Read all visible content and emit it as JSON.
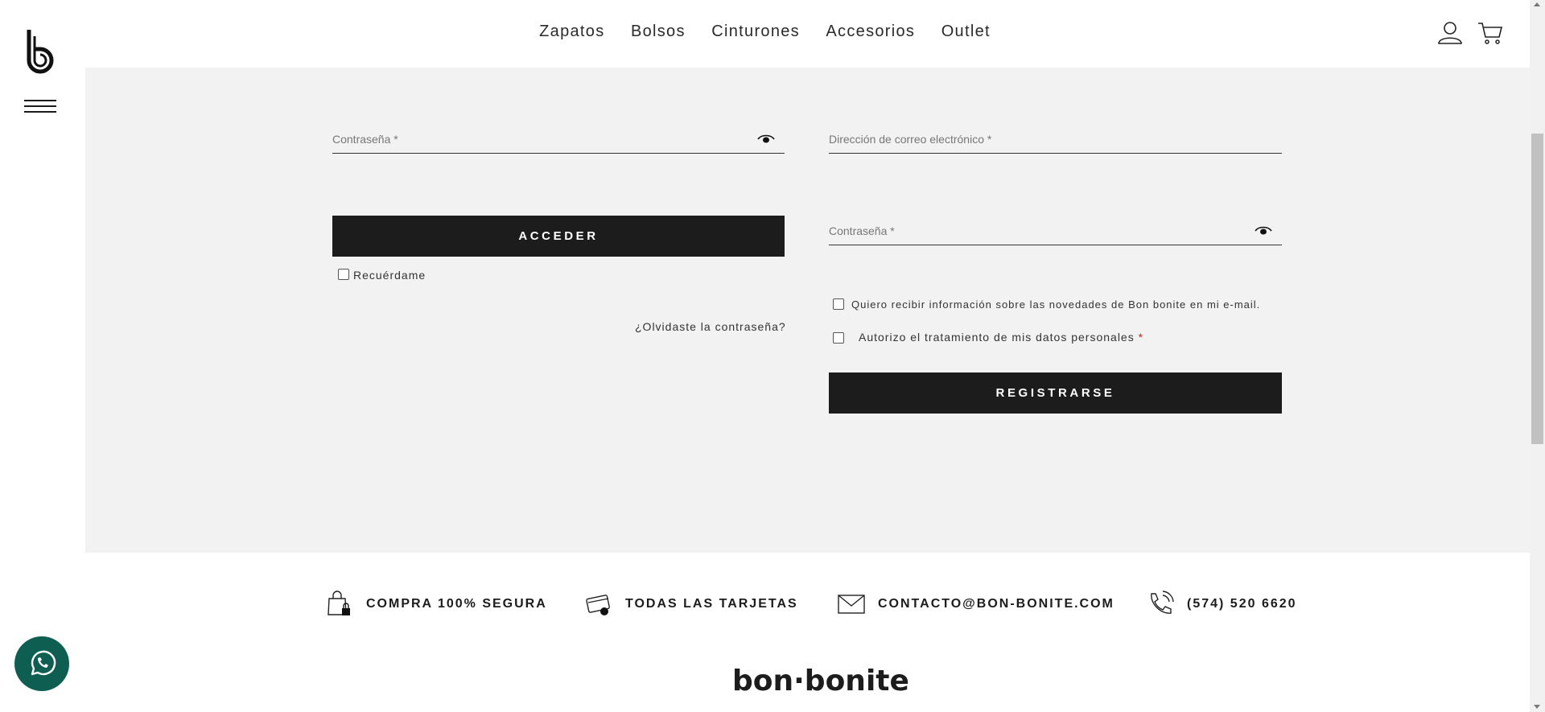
{
  "header": {
    "nav": [
      "Zapatos",
      "Bolsos",
      "Cinturones",
      "Accesorios",
      "Outlet"
    ],
    "logo_icon": "bonbonite-b-logo",
    "menu_icon": "hamburger-icon",
    "user_icon": "user-icon",
    "cart_icon": "cart-icon"
  },
  "login": {
    "password_label": "Contraseña *",
    "submit_label": "ACCEDER",
    "remember_label": "Recuérdame",
    "remember_checked": false,
    "forgot_link": "¿Olvidaste la contraseña?"
  },
  "register": {
    "email_label": "Dirección de correo electrónico *",
    "password_label": "Contraseña *",
    "newsletter_label": "Quiero recibir información sobre las novedades de Bon bonite en mi e-mail.",
    "newsletter_checked": false,
    "terms_label": "Autorizo el tratamiento de mis datos personales",
    "terms_required": "*",
    "terms_checked": false,
    "submit_label": "REGISTRARSE"
  },
  "features": [
    {
      "icon": "secure-bag-icon",
      "text": "COMPRA 100% SEGURA"
    },
    {
      "icon": "credit-card-icon",
      "text": "TODAS LAS TARJETAS"
    },
    {
      "icon": "envelope-icon",
      "text": "CONTACTO@BON-BONITE.COM"
    },
    {
      "icon": "phone-icon",
      "text": "(574) 520 6620"
    }
  ],
  "footer": {
    "logo_text": "bon·bonite"
  },
  "colors": {
    "panel_bg": "#f2f2f2",
    "button_bg": "#1c1c1c",
    "whatsapp": "#0e5e52",
    "required": "#d21f1f"
  }
}
